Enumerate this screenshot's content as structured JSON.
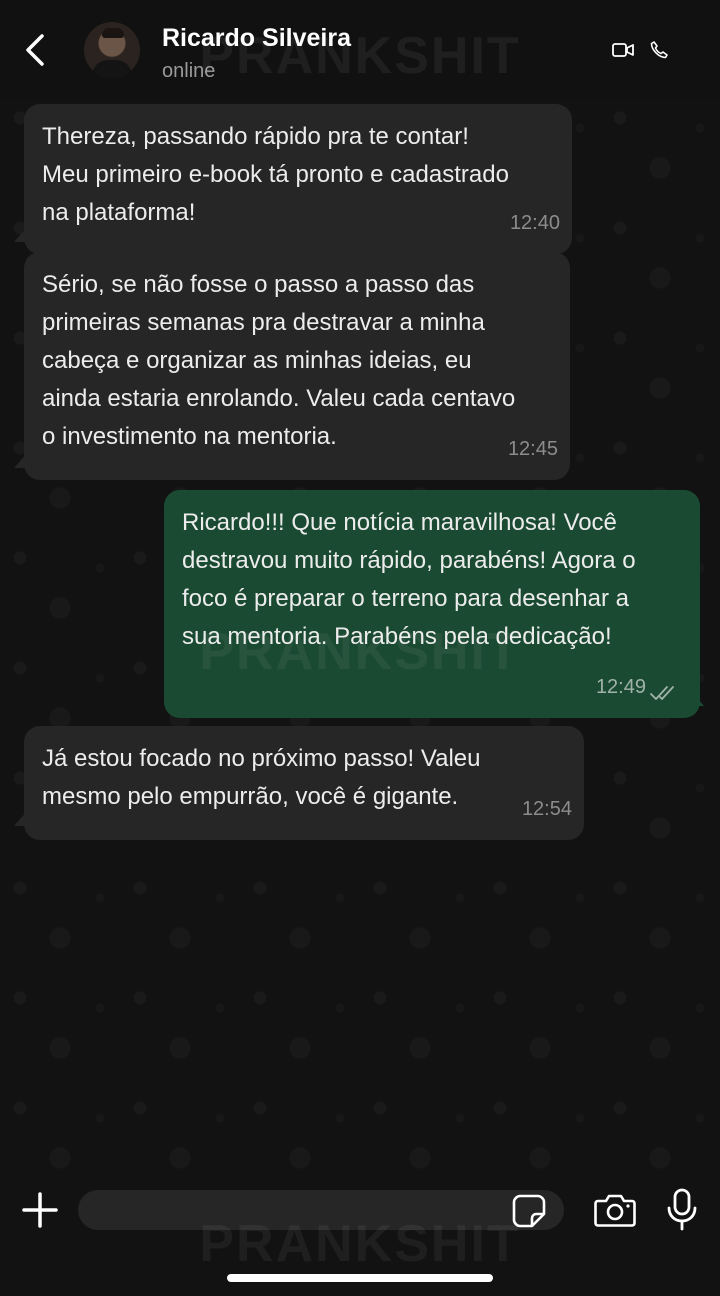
{
  "header": {
    "contact_name": "Ricardo Silveira",
    "status": "online"
  },
  "watermark": "PRANKSHIT",
  "messages": [
    {
      "direction": "incoming",
      "text": "Thereza, passando rápido pra te contar!\nMeu primeiro e-book tá pronto e cadastrado\nna plataforma!",
      "time": "12:40"
    },
    {
      "direction": "incoming",
      "text": "Sério, se não fosse o passo a passo das\nprimeiras semanas pra destravar a minha\ncabeça e organizar as minhas ideias, eu\nainda estaria enrolando. Valeu cada centavo\no investimento na mentoria.",
      "time": "12:45"
    },
    {
      "direction": "outgoing",
      "text": "Ricardo!!! Que notícia maravilhosa! Você\ndestravou muito rápido, parabéns! Agora o\nfoco é preparar o terreno para desenhar a\nsua mentoria. Parabéns pela dedicação!",
      "time": "12:49",
      "status_icon": "double-check-icon"
    },
    {
      "direction": "incoming",
      "text": "Já estou focado no próximo passo! Valeu\nmesmo pelo empurrão, você é gigante.",
      "time": "12:54"
    }
  ],
  "composer": {
    "placeholder": ""
  },
  "icons": [
    "back-arrow-icon",
    "video-call-icon",
    "phone-icon",
    "plus-icon",
    "sticker-icon",
    "camera-icon",
    "microphone-icon"
  ],
  "colors": {
    "incoming_bubble": "#262626",
    "outgoing_bubble": "#1b4a32",
    "background": "#121212"
  }
}
